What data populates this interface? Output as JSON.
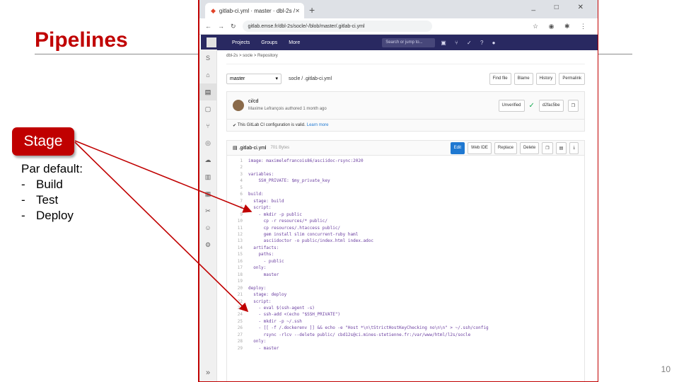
{
  "slide": {
    "title": "Pipelines",
    "stage_label": "Stage",
    "default_heading": "Par default:",
    "default_stages": [
      "Build",
      "Test",
      "Deploy"
    ],
    "page_number": "10"
  },
  "browser": {
    "tab_title": "gitlab-ci.yml · master · dbl-2s / ...",
    "new_tab": "+",
    "url": "gitlab.emse.fr/dbl-2s/socle/-/blob/master/.gitlab-ci.yml",
    "gitlab_menu": [
      "Projects",
      "Groups",
      "More"
    ],
    "search_placeholder": "Search or jump to..."
  },
  "repo": {
    "breadcrumb": "dbl-2s > socle > Repository",
    "branch": "master",
    "path": "socle / .gitlab-ci.yml",
    "buttons": [
      "Find file",
      "Blame",
      "History",
      "Permalink"
    ],
    "commit_message": "ci/cd",
    "commit_author": "Maxime Lefrançois authored 1 month ago",
    "commit_status": "Unverified",
    "commit_sha": "d2fac5be",
    "ci_valid_text": "This GitLab CI configuration is valid.",
    "ci_learn_more": "Learn more",
    "file_name": ".gitlab-ci.yml",
    "file_size": "701 Bytes",
    "file_buttons": [
      "Edit",
      "Web IDE",
      "Replace",
      "Delete"
    ],
    "code_lines": [
      "image: maximelefrancois86/asciidoc-rsync:2020",
      "",
      "variables:",
      "    SSH_PRIVATE: $my_private_key",
      "",
      "build:",
      "  stage: build",
      "  script:",
      "    - mkdir -p public",
      "      cp -r resources/* public/",
      "      cp resources/.htaccess public/",
      "      gem install slim concurrent-ruby haml",
      "      asciidoctor -o public/index.html index.adoc",
      "  artifacts:",
      "    paths:",
      "      - public",
      "  only:",
      "      master",
      "",
      "deploy:",
      "  stage: deploy",
      "  script:",
      "    - eval $(ssh-agent -s)",
      "    - ssh-add <(echo \"$SSH_PRIVATE\")",
      "    - mkdir -p ~/.ssh",
      "    - [[ -f /.dockerenv ]] && echo -e \"Host *\\n\\tStrictHostKeyChecking no\\n\\n\" > ~/.ssh/config",
      "      rsync -rlcv --delete public/ cbd12s@ci.mines-stetienne.fr:/var/www/html/l2s/socle",
      "  only:",
      "    - master"
    ]
  }
}
